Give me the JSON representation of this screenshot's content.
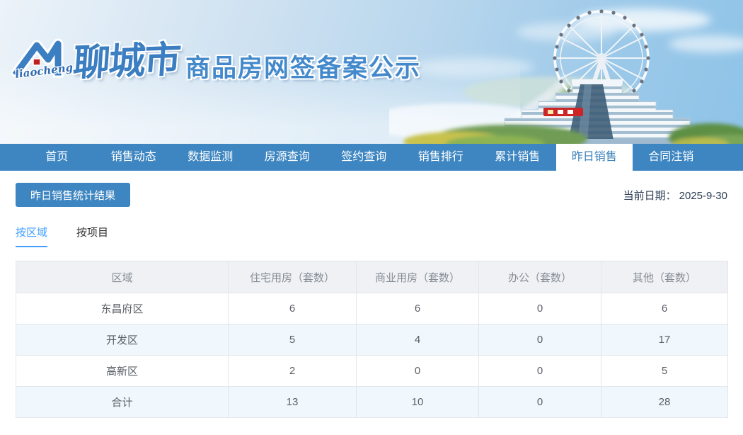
{
  "banner": {
    "logo_script": "liaocheng",
    "logo_city": "聊城市",
    "title": "商品房网签备案公示"
  },
  "nav": {
    "items": [
      {
        "label": "首页",
        "active": false
      },
      {
        "label": "销售动态",
        "active": false
      },
      {
        "label": "数据监测",
        "active": false
      },
      {
        "label": "房源查询",
        "active": false
      },
      {
        "label": "签约查询",
        "active": false
      },
      {
        "label": "销售排行",
        "active": false
      },
      {
        "label": "累计销售",
        "active": false
      },
      {
        "label": "昨日销售",
        "active": true
      },
      {
        "label": "合同注销",
        "active": false
      }
    ]
  },
  "toolbar": {
    "result_button": "昨日销售统计结果",
    "date_label": "当前日期：",
    "date_value": "2025-9-30"
  },
  "tabs": [
    {
      "label": "按区域",
      "active": true
    },
    {
      "label": "按项目",
      "active": false
    }
  ],
  "table": {
    "columns": [
      "区域",
      "住宅用房（套数）",
      "商业用房（套数）",
      "办公（套数）",
      "其他（套数）"
    ],
    "rows": [
      [
        "东昌府区",
        "6",
        "6",
        "0",
        "6"
      ],
      [
        "开发区",
        "5",
        "4",
        "0",
        "17"
      ],
      [
        "高新区",
        "2",
        "0",
        "0",
        "5"
      ],
      [
        "合计",
        "13",
        "10",
        "0",
        "28"
      ]
    ]
  },
  "colors": {
    "nav_blue": "#3e86c1",
    "nav_active_text": "#3a80ba",
    "tab_active_blue": "#409eff",
    "title_blue": "#4389cb",
    "logo_blue": "#3b7ec2",
    "logo_red": "#c01f1f",
    "table_header_bg": "#eff1f4",
    "table_stripe_bg": "#f0f7fd",
    "table_border": "#e3e6eb",
    "date_text": "#2e3d55"
  }
}
